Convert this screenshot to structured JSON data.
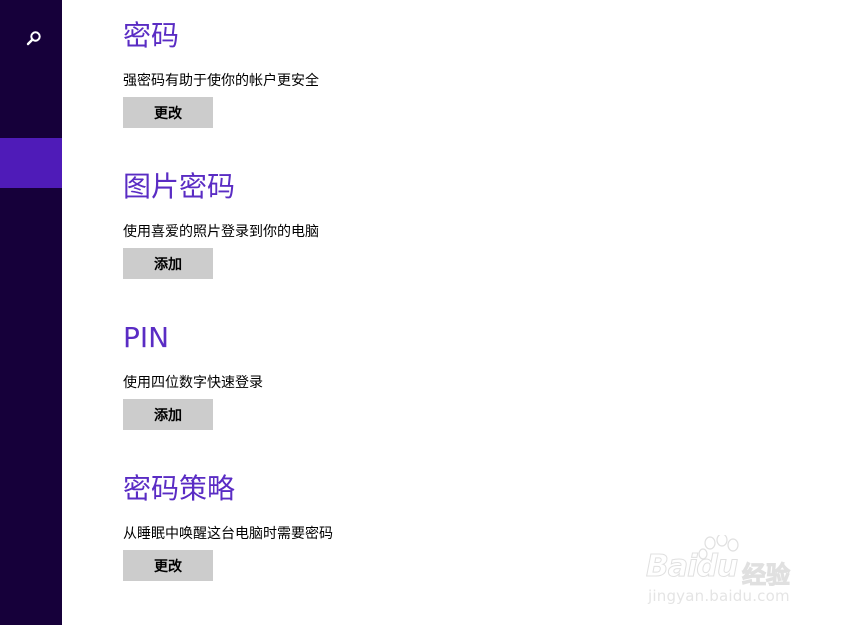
{
  "sidebar": {
    "search_icon": "search-icon",
    "colors": {
      "background": "#16003a",
      "selected": "#4f1bb8"
    }
  },
  "accent_color": "#5a2cc4",
  "button_color": "#cccccc",
  "sections": [
    {
      "title": "密码",
      "description": "强密码有助于使你的帐户更安全",
      "button": "更改"
    },
    {
      "title": "图片密码",
      "description": "使用喜爱的照片登录到你的电脑",
      "button": "添加"
    },
    {
      "title": "PIN",
      "description": "使用四位数字快速登录",
      "button": "添加"
    },
    {
      "title": "密码策略",
      "description": "从睡眠中唤醒这台电脑时需要密码",
      "button": "更改"
    }
  ],
  "watermark": {
    "brand": "Baidu",
    "product": "经验",
    "url": "jingyan.baidu.com"
  }
}
